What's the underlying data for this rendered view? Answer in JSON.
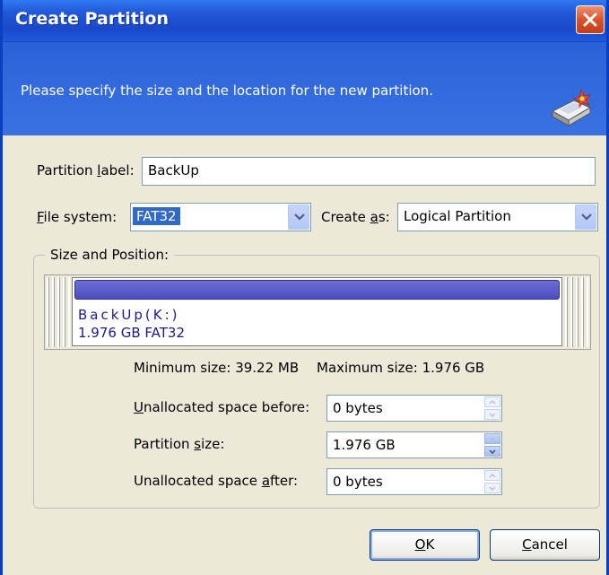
{
  "window": {
    "title": "Create Partition",
    "close_icon": "close-icon"
  },
  "header": {
    "instruction": "Please specify the size and the location for the new partition.",
    "icon": "partition-wizard-icon"
  },
  "form": {
    "partition_label": {
      "label_pre": "Partition ",
      "label_key": "l",
      "label_post": "abel:",
      "value": "BackUp"
    },
    "file_system": {
      "label_key": "F",
      "label_post": "ile system:",
      "value": "FAT32"
    },
    "create_as": {
      "label_pre": "Create ",
      "label_key": "a",
      "label_post": "s:",
      "value": "Logical Partition"
    }
  },
  "size_position": {
    "group_title": "Size and Position:",
    "partition_name": "BackUp(K:)",
    "partition_info": "1.976 GB  FAT32",
    "min_size_text": "Minimum size: 39.22 MB",
    "max_size_text": "Maximum size: 1.976 GB",
    "unallocated_before": {
      "label_key": "U",
      "label_post": "nallocated space before:",
      "value": "0 bytes"
    },
    "partition_size": {
      "label_pre": "Partition ",
      "label_key": "s",
      "label_post": "ize:",
      "value": "1.976 GB"
    },
    "unallocated_after": {
      "label_pre": "Unallocated space ",
      "label_key": "a",
      "label_post": "fter:",
      "value": "0 bytes"
    }
  },
  "buttons": {
    "ok_key": "O",
    "ok_post": "K",
    "cancel_key": "C",
    "cancel_post": "ancel"
  },
  "colors": {
    "title_bar": "#1f57de",
    "partition_bar": "#5a5ac8",
    "selection": "#316ac5"
  }
}
